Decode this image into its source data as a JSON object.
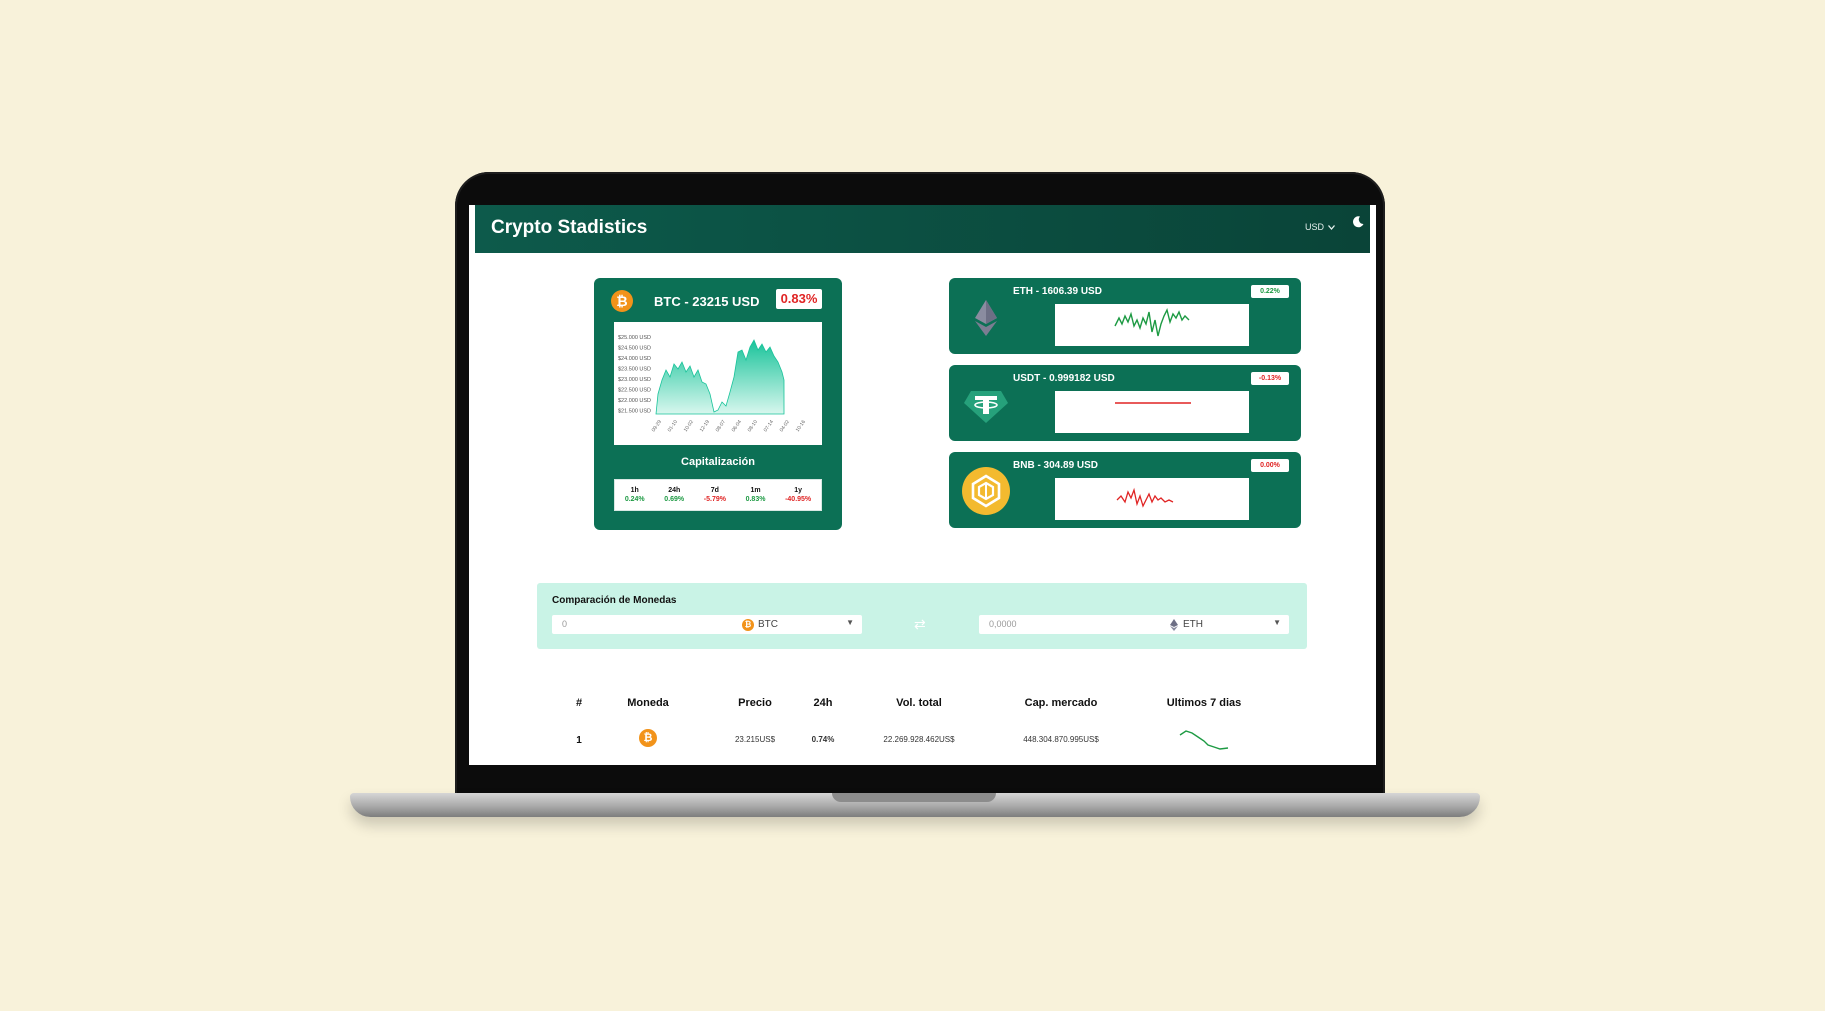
{
  "header": {
    "title": "Crypto Stadistics",
    "currency": "USD"
  },
  "btc_card": {
    "title": "BTC - 23215 USD",
    "change": "0.83%",
    "chart_y_ticks": [
      "$25.000 USD",
      "$24.500 USD",
      "$24.000 USD",
      "$23.500 USD",
      "$23.000 USD",
      "$22.500 USD",
      "$22.000 USD",
      "$21.500 USD"
    ],
    "capitalizacion_title": "Capitalización",
    "capitalizacion": [
      {
        "label": "1h",
        "value": "0.24%",
        "positive": true
      },
      {
        "label": "24h",
        "value": "0.69%",
        "positive": true
      },
      {
        "label": "7d",
        "value": "-5.79%",
        "positive": false
      },
      {
        "label": "1m",
        "value": "0.83%",
        "positive": true
      },
      {
        "label": "1y",
        "value": "-40.95%",
        "positive": false
      }
    ]
  },
  "mini_cards": [
    {
      "title": "ETH - 1606.39 USD",
      "change": "0.22%",
      "line_color": "#1d9a43"
    },
    {
      "title": "USDT - 0.999182 USD",
      "change": "-0.13%",
      "line_color": "#e02424"
    },
    {
      "title": "BNB - 304.89 USD",
      "change": "0.00%",
      "line_color": "#e02424"
    }
  ],
  "converter": {
    "title": "Comparación de Monedas",
    "from_value": "0",
    "from_coin": "BTC",
    "to_value": "0,0000",
    "to_coin": "ETH"
  },
  "table": {
    "headers": [
      "#",
      "Moneda",
      "Precio",
      "24h",
      "Vol. total",
      "Cap. mercado",
      "Ultimos 7 dias"
    ],
    "rows": [
      {
        "rank": "1",
        "price": "23.215US$",
        "change_24h": "0.74%",
        "volume": "22.269.928.462US$",
        "market_cap": "448.304.870.995US$"
      }
    ]
  },
  "colors": {
    "brand": "#0c7055",
    "header": "#0d5a4b",
    "positive": "#1d9a43",
    "negative": "#e02424",
    "btc": "#f2931a"
  }
}
